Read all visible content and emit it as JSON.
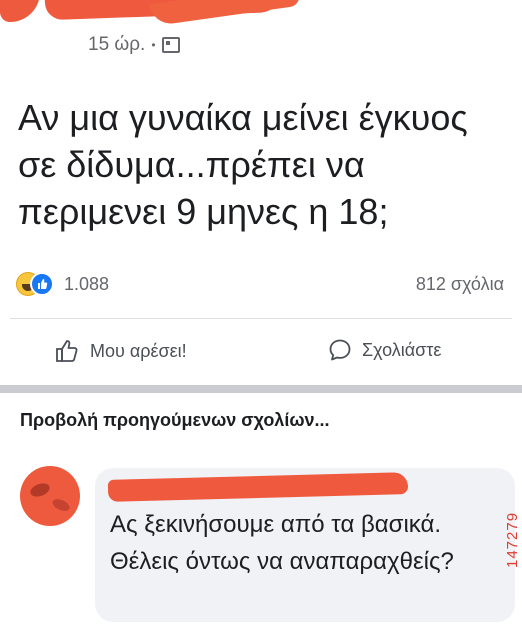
{
  "post": {
    "time": "15 ώρ.",
    "separator": "•",
    "text": "Αν μια γυναίκα μείνει έγκυος σε δίδυμα...πρέπει να περιμενει 9 μηνες η 18;",
    "reactions_count": "1.088",
    "comments_count": "812 σχόλια",
    "like_label": "Μου αρέσει!",
    "comment_label": "Σχολιάστε",
    "icons": [
      "photo-icon",
      "haha-icon",
      "like-icon",
      "thumb-up-icon",
      "comment-bubble-icon"
    ]
  },
  "comments_section": {
    "view_previous": "Προβολή προηγούμενων σχολίων...",
    "comment": {
      "text": "Ας ξεκινήσουμε από τα βασικά. Θέλεις όντως να αναπαραχθείς?"
    }
  },
  "watermark": "147279",
  "colors": {
    "redaction": "#ef5a3f",
    "facebook_blue": "#1877f2",
    "secondary_text": "#65676b"
  }
}
